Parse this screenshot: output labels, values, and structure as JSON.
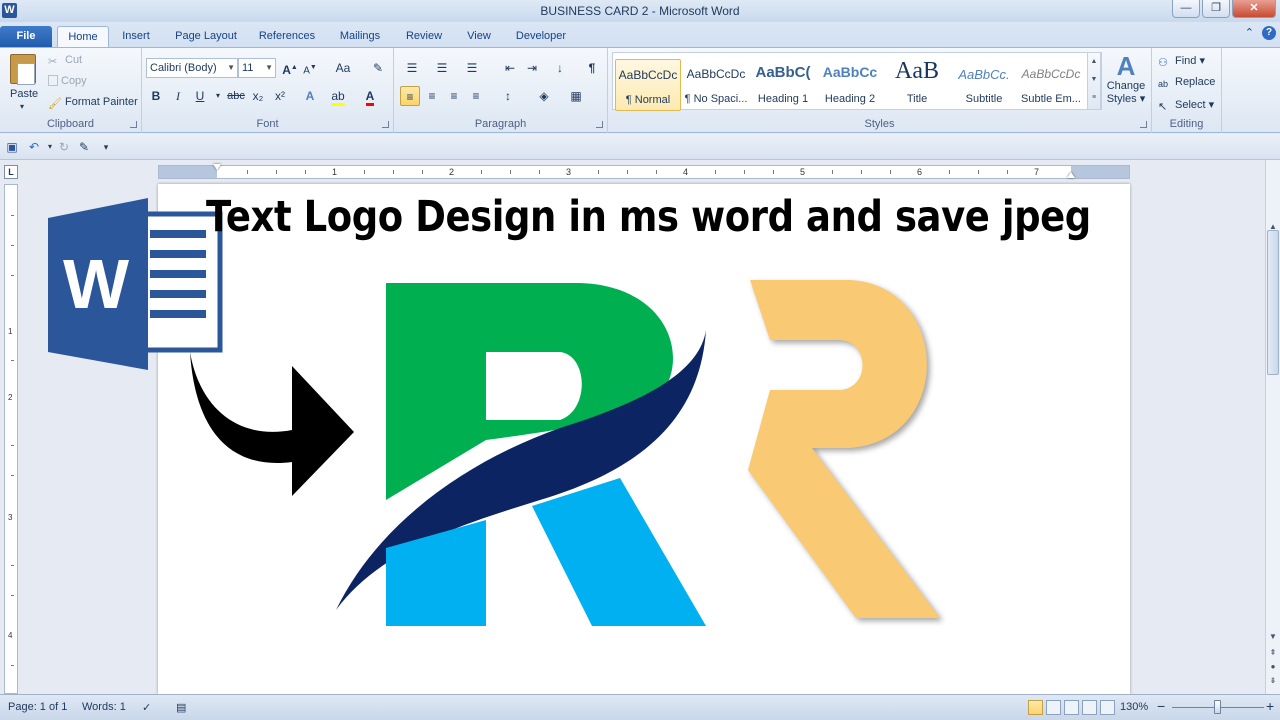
{
  "window": {
    "title": "BUSINESS CARD 2  -  Microsoft Word",
    "app_icon_letter": "W",
    "minimize": "—",
    "maximize": "❐",
    "close": "✕"
  },
  "tabs": [
    {
      "label": "File"
    },
    {
      "label": "Home"
    },
    {
      "label": "Insert"
    },
    {
      "label": "Page Layout"
    },
    {
      "label": "References"
    },
    {
      "label": "Mailings"
    },
    {
      "label": "Review"
    },
    {
      "label": "View"
    },
    {
      "label": "Developer"
    }
  ],
  "clipboard": {
    "paste": "Paste",
    "cut": "Cut",
    "copy": "Copy",
    "format_painter": "Format Painter",
    "group_label": "Clipboard"
  },
  "font": {
    "name": "Calibri (Body)",
    "size": "11",
    "grow": "A",
    "shrink": "A",
    "change_case": "Aa",
    "bold": "B",
    "italic": "I",
    "underline": "U",
    "strikethrough": "abc",
    "subscript": "x₂",
    "superscript": "x²",
    "font_color_letter": "A",
    "group_label": "Font"
  },
  "paragraph": {
    "pilcrow": "¶",
    "group_label": "Paragraph"
  },
  "styles": {
    "items": [
      {
        "sample": "AaBbCcDc",
        "name": "¶ Normal"
      },
      {
        "sample": "AaBbCcDc",
        "name": "¶ No Spaci..."
      },
      {
        "sample": "AaBbC(",
        "name": "Heading 1"
      },
      {
        "sample": "AaBbCc",
        "name": "Heading 2"
      },
      {
        "sample": "AaB",
        "name": "Title"
      },
      {
        "sample": "AaBbCc.",
        "name": "Subtitle"
      },
      {
        "sample": "AaBbCcDc",
        "name": "Subtle Em..."
      }
    ],
    "change_styles_line1": "Change",
    "change_styles_line2": "Styles",
    "group_label": "Styles"
  },
  "editing": {
    "find": "Find",
    "replace": "Replace",
    "select": "Select",
    "group_label": "Editing"
  },
  "ruler": {
    "numbers": [
      "1",
      "2",
      "3",
      "4",
      "5",
      "6",
      "7"
    ],
    "corner": "L"
  },
  "vruler": {
    "numbers": [
      "1",
      "2",
      "3",
      "4"
    ]
  },
  "document": {
    "headline": "Text Logo Design in ms word and save jpeg",
    "word_icon_letter": "W"
  },
  "status": {
    "page": "Page: 1 of 1",
    "words": "Words: 1",
    "zoom": "130%",
    "zoom_minus": "−",
    "zoom_plus": "+"
  },
  "colors": {
    "logo_green": "#00b050",
    "logo_navy": "#0c2461",
    "logo_cyan": "#00b0f0",
    "logo_gold": "#f9c974",
    "word_blue": "#2b579a"
  }
}
